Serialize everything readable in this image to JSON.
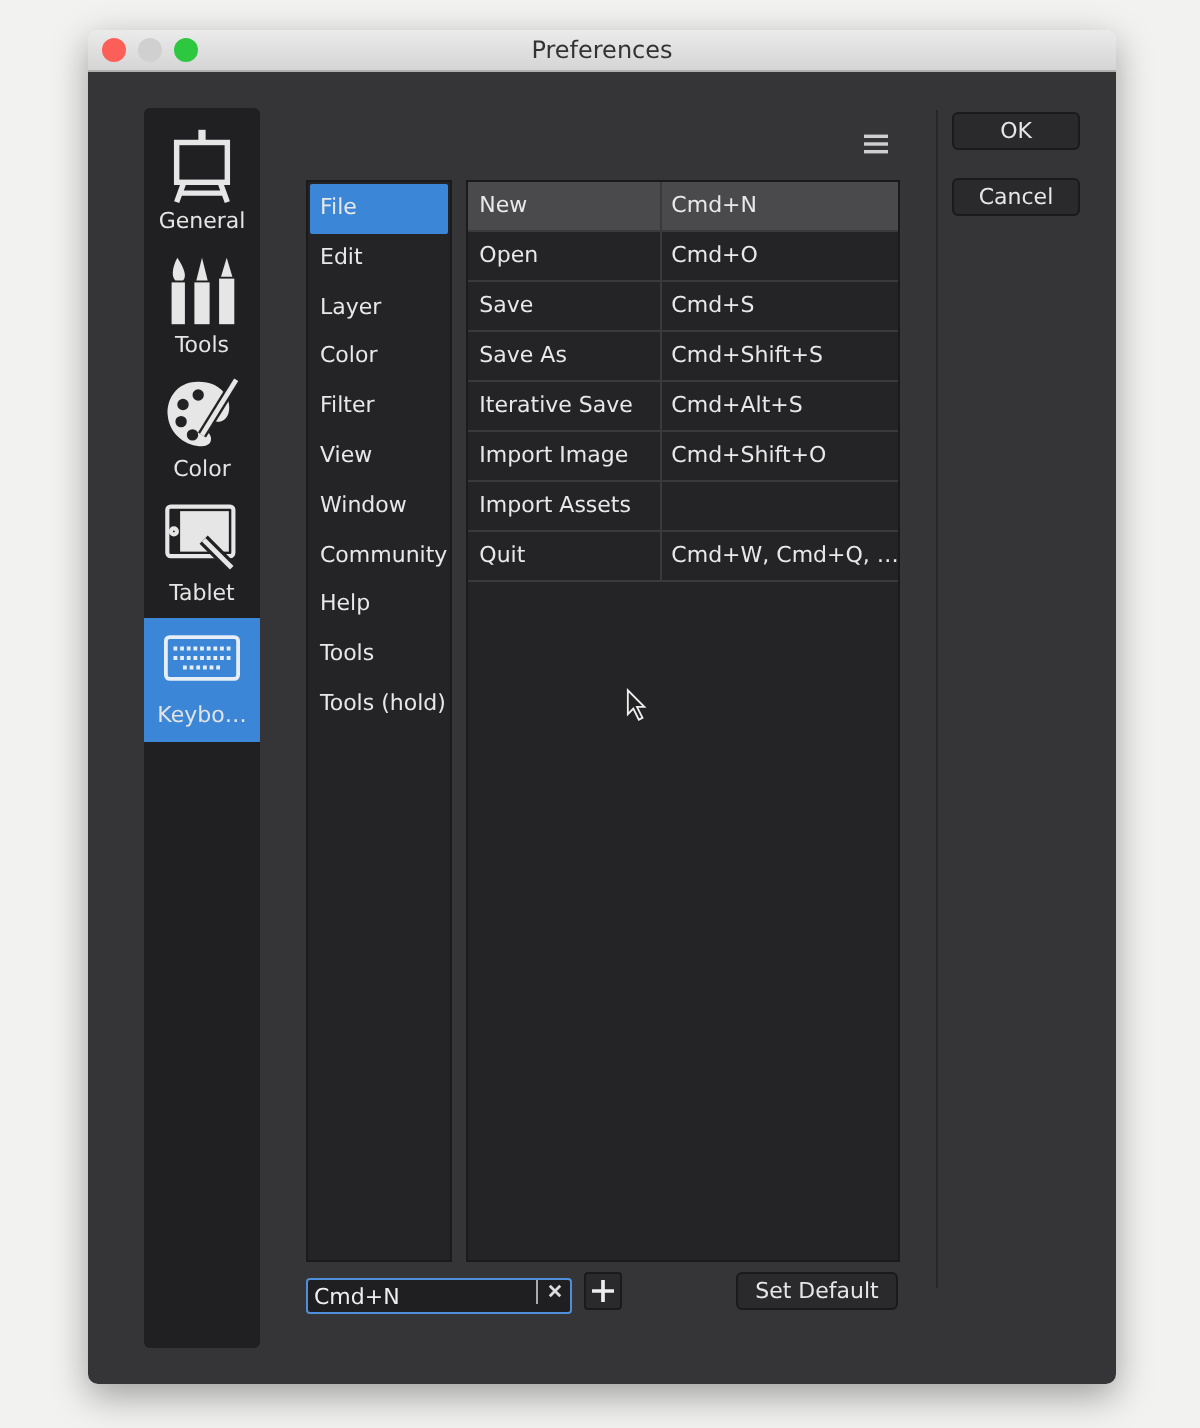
{
  "window": {
    "title": "Preferences"
  },
  "sidebar": {
    "items": [
      {
        "label": "General",
        "kind": "easel",
        "selected": false
      },
      {
        "label": "Tools",
        "kind": "brushes",
        "selected": false
      },
      {
        "label": "Color",
        "kind": "palette",
        "selected": false
      },
      {
        "label": "Tablet",
        "kind": "tablet",
        "selected": false
      },
      {
        "label": "Keybo…",
        "kind": "keyboard",
        "selected": true
      }
    ]
  },
  "categories": [
    {
      "label": "File",
      "selected": true
    },
    {
      "label": "Edit",
      "selected": false
    },
    {
      "label": "Layer",
      "selected": false
    },
    {
      "label": "Color",
      "selected": false
    },
    {
      "label": "Filter",
      "selected": false
    },
    {
      "label": "View",
      "selected": false
    },
    {
      "label": "Window",
      "selected": false
    },
    {
      "label": "Community",
      "selected": false
    },
    {
      "label": "Help",
      "selected": false
    },
    {
      "label": "Tools",
      "selected": false
    },
    {
      "label": "Tools (hold)",
      "selected": false
    }
  ],
  "shortcuts": [
    {
      "action": "New",
      "keys": "Cmd+N",
      "selected": true
    },
    {
      "action": "Open",
      "keys": "Cmd+O",
      "selected": false
    },
    {
      "action": "Save",
      "keys": "Cmd+S",
      "selected": false
    },
    {
      "action": "Save As",
      "keys": "Cmd+Shift+S",
      "selected": false
    },
    {
      "action": "Iterative Save",
      "keys": "Cmd+Alt+S",
      "selected": false
    },
    {
      "action": "Import Image",
      "keys": "Cmd+Shift+O",
      "selected": false
    },
    {
      "action": "Import Assets",
      "selected": false
    },
    {
      "action": "Quit",
      "keys": "Cmd+W, Cmd+Q, …",
      "selected": false
    }
  ],
  "shortcut_field": {
    "value": "Cmd+N"
  },
  "set_default_button": "Set Default",
  "buttons": [
    "OK",
    "Cancel"
  ]
}
